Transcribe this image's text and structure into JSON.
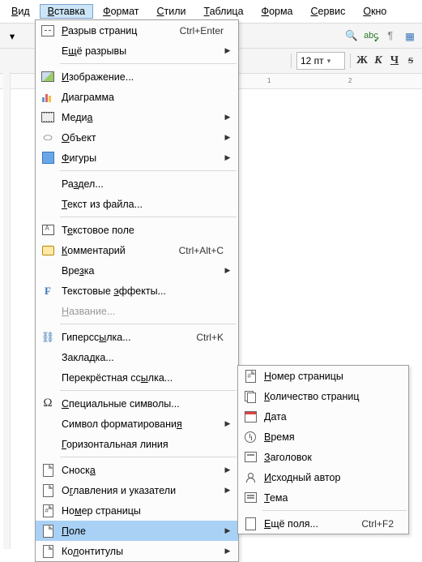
{
  "menubar": [
    "Вид",
    "Вставка",
    "Формат",
    "Стили",
    "Таблица",
    "Форма",
    "Сервис",
    "Окно"
  ],
  "menubar_open": 1,
  "font_size": "12 пт",
  "fmt_buttons": [
    "Ж",
    "К",
    "Ч",
    "S"
  ],
  "insert_menu": {
    "groups": [
      [
        {
          "icon": "break",
          "label": "<u>Р</u>азрыв страниц",
          "sc": "Ctrl+Enter"
        },
        {
          "icon": "",
          "label": "Е<u>щ</u>ё разрывы",
          "sub": true
        }
      ],
      [
        {
          "icon": "img",
          "label": "<u>И</u>зображение..."
        },
        {
          "icon": "chart",
          "label": "Диаграмма"
        },
        {
          "icon": "media",
          "label": "Меди<u>а</u>",
          "sub": true
        },
        {
          "icon": "obj",
          "label": "<u>О</u>бъект",
          "sub": true
        },
        {
          "icon": "shape",
          "label": "<u>Ф</u>игуры",
          "sub": true
        }
      ],
      [
        {
          "icon": "",
          "label": "Ра<u>з</u>дел..."
        },
        {
          "icon": "",
          "label": "<u>Т</u>екст из файла..."
        }
      ],
      [
        {
          "icon": "tbox",
          "label": "Т<u>е</u>кстовое поле"
        },
        {
          "icon": "comm",
          "label": "<u>К</u>омментарий",
          "sc": "Ctrl+Alt+C"
        },
        {
          "icon": "",
          "label": "Вре<u>з</u>ка",
          "sub": true
        },
        {
          "icon": "fx",
          "label": "Текстовые <u>э</u>ффекты..."
        },
        {
          "icon": "",
          "label": "<u>Н</u>азвание...",
          "dis": true
        }
      ],
      [
        {
          "icon": "link",
          "label": "Гиперсс<u>ы</u>лка...",
          "sc": "Ctrl+K"
        },
        {
          "icon": "",
          "label": "Закла<u>д</u>ка..."
        },
        {
          "icon": "",
          "label": "Перекрёстная сс<u>ы</u>лка..."
        }
      ],
      [
        {
          "icon": "omega",
          "label": "<u>С</u>пециальные символы..."
        },
        {
          "icon": "",
          "label": "Символ форматировани<u>я</u>",
          "sub": true
        },
        {
          "icon": "",
          "label": "<u>Г</u>оризонтальная линия"
        }
      ],
      [
        {
          "icon": "page",
          "label": "Сноск<u>а</u>",
          "sub": true
        },
        {
          "icon": "page",
          "label": "О<u>г</u>лавления и указатели",
          "sub": true
        },
        {
          "icon": "pagen",
          "label": "Но<u>м</u>ер страницы"
        },
        {
          "icon": "page",
          "label": "<u>П</u>оле",
          "sub": true,
          "sel": true
        },
        {
          "icon": "page",
          "label": "Ко<u>л</u>онтитулы",
          "sub": true
        }
      ]
    ]
  },
  "field_submenu": [
    [
      {
        "icon": "pagen",
        "label": "<u>Н</u>омер страницы"
      },
      {
        "icon": "pages",
        "label": "<u>К</u>оличество страниц"
      },
      {
        "icon": "cal",
        "label": "<u>Д</u>ата"
      },
      {
        "icon": "clock",
        "label": "<u>В</u>ремя"
      },
      {
        "icon": "title",
        "label": "<u>З</u>аголовок"
      },
      {
        "icon": "auth",
        "label": "<u>И</u>сходный автор"
      },
      {
        "icon": "theme",
        "label": "<u>Т</u>ема"
      }
    ],
    [
      {
        "icon": "more",
        "label": "<u>Е</u>щё поля...",
        "sc": "Ctrl+F2"
      }
    ]
  ],
  "toolbar_icons": [
    "🔍",
    "abc",
    "¶",
    "▦"
  ],
  "ruler_marks": [
    "1",
    "2"
  ]
}
